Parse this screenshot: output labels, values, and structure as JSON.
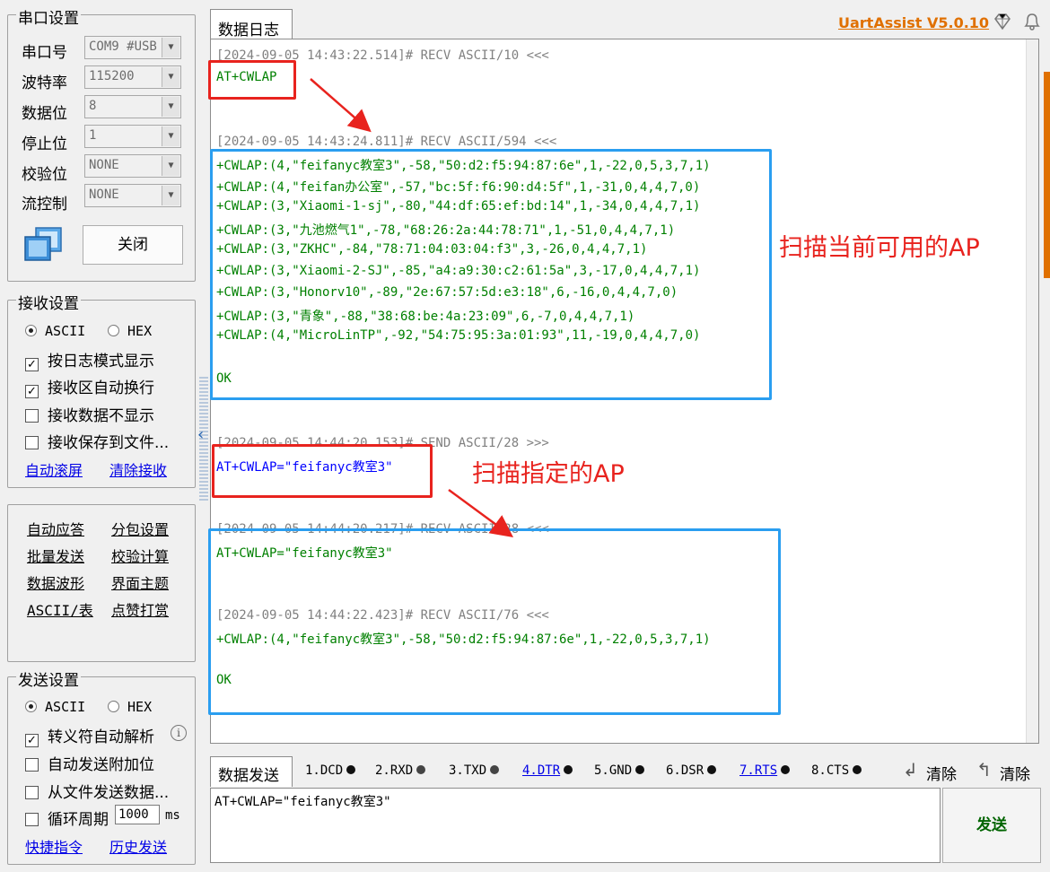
{
  "serial_settings": {
    "title": "串口设置",
    "fields": [
      {
        "label": "串口号",
        "value": "COM9 #USB"
      },
      {
        "label": "波特率",
        "value": "115200"
      },
      {
        "label": "数据位",
        "value": "8"
      },
      {
        "label": "停止位",
        "value": "1"
      },
      {
        "label": "校验位",
        "value": "NONE"
      },
      {
        "label": "流控制",
        "value": "NONE"
      }
    ],
    "close_button": "关闭"
  },
  "receive_settings": {
    "title": "接收设置",
    "radio_ascii": "ASCII",
    "radio_hex": "HEX",
    "options": [
      {
        "label": "按日志模式显示",
        "checked": true
      },
      {
        "label": "接收区自动换行",
        "checked": true
      },
      {
        "label": "接收数据不显示",
        "checked": false
      },
      {
        "label": "接收保存到文件...",
        "checked": false
      }
    ],
    "link_auto_scroll": "自动滚屏",
    "link_clear_receive": "清除接收"
  },
  "tools": {
    "items": [
      "自动应答",
      "分包设置",
      "批量发送",
      "校验计算",
      "数据波形",
      "界面主题",
      "ASCII/表",
      "点赞打赏"
    ]
  },
  "send_settings": {
    "title": "发送设置",
    "radio_ascii": "ASCII",
    "radio_hex": "HEX",
    "options": [
      {
        "label": "转义符自动解析",
        "checked": true
      },
      {
        "label": "自动发送附加位",
        "checked": false
      },
      {
        "label": "从文件发送数据...",
        "checked": false
      },
      {
        "label": "循环周期",
        "checked": false
      }
    ],
    "period_value": "1000",
    "period_unit": "ms",
    "link_shortcuts": "快捷指令",
    "link_history": "历史发送"
  },
  "log": {
    "tab": "数据日志",
    "app_title": "UartAssist V5.0.10",
    "lines": [
      {
        "text": "[2024-09-05 14:43:22.514]# RECV ASCII/10 <<<",
        "color": "grey"
      },
      {
        "text": "AT+CWLAP",
        "color": "green"
      },
      {
        "text": "[2024-09-05 14:43:24.811]# RECV ASCII/594 <<<",
        "color": "grey"
      },
      {
        "text": "+CWLAP:(4,\"feifanyc教室3\",-58,\"50:d2:f5:94:87:6e\",1,-22,0,5,3,7,1)",
        "color": "green"
      },
      {
        "text": "+CWLAP:(4,\"feifan办公室\",-57,\"bc:5f:f6:90:d4:5f\",1,-31,0,4,4,7,0)",
        "color": "green"
      },
      {
        "text": "+CWLAP:(3,\"Xiaomi-1-sj\",-80,\"44:df:65:ef:bd:14\",1,-34,0,4,4,7,1)",
        "color": "green"
      },
      {
        "text": "+CWLAP:(3,\"九池燃气1\",-78,\"68:26:2a:44:78:71\",1,-51,0,4,4,7,1)",
        "color": "green"
      },
      {
        "text": "+CWLAP:(3,\"ZKHC\",-84,\"78:71:04:03:04:f3\",3,-26,0,4,4,7,1)",
        "color": "green"
      },
      {
        "text": "+CWLAP:(3,\"Xiaomi-2-SJ\",-85,\"a4:a9:30:c2:61:5a\",3,-17,0,4,4,7,1)",
        "color": "green"
      },
      {
        "text": "+CWLAP:(3,\"Honorv10\",-89,\"2e:67:57:5d:e3:18\",6,-16,0,4,4,7,0)",
        "color": "green"
      },
      {
        "text": "+CWLAP:(3,\"青象\",-88,\"38:68:be:4a:23:09\",6,-7,0,4,4,7,1)",
        "color": "green"
      },
      {
        "text": "+CWLAP:(4,\"MicroLinTP\",-92,\"54:75:95:3a:01:93\",11,-19,0,4,4,7,0)",
        "color": "green"
      },
      {
        "text": "OK",
        "color": "green"
      },
      {
        "text": "[2024-09-05 14:44:20.153]# SEND ASCII/28 >>>",
        "color": "grey"
      },
      {
        "text": "AT+CWLAP=\"feifanyc教室3\"",
        "color": "blue"
      },
      {
        "text": "[2024-09-05 14:44:20.217]# RECV ASCII/28 <<<",
        "color": "grey"
      },
      {
        "text": "AT+CWLAP=\"feifanyc教室3\"",
        "color": "green"
      },
      {
        "text": "[2024-09-05 14:44:22.423]# RECV ASCII/76 <<<",
        "color": "grey"
      },
      {
        "text": "+CWLAP:(4,\"feifanyc教室3\",-58,\"50:d2:f5:94:87:6e\",1,-22,0,5,3,7,1)",
        "color": "green"
      },
      {
        "text": "OK",
        "color": "green"
      }
    ]
  },
  "annotations": {
    "scan_all": "扫描当前可用的AP",
    "scan_specific": "扫描指定的AP"
  },
  "send": {
    "tab": "数据发送",
    "signals": [
      {
        "label": "1.DCD",
        "link": false
      },
      {
        "label": "2.RXD",
        "link": false
      },
      {
        "label": "3.TXD",
        "link": false
      },
      {
        "label": "4.DTR",
        "link": true
      },
      {
        "label": "5.GND",
        "link": false
      },
      {
        "label": "6.DSR",
        "link": false
      },
      {
        "label": "7.RTS",
        "link": true
      },
      {
        "label": "8.CTS",
        "link": false
      }
    ],
    "clear1": "清除",
    "clear2": "清除",
    "input_value": "AT+CWLAP=\"feifanyc教室3\"",
    "send_button": "发送"
  },
  "colors": {
    "annotation_red": "#e8231e",
    "annotation_blue": "#2a9ef0",
    "log_green": "#008000",
    "log_blue": "#0000ff",
    "log_grey": "#808080",
    "brand_orange": "#e07000"
  }
}
